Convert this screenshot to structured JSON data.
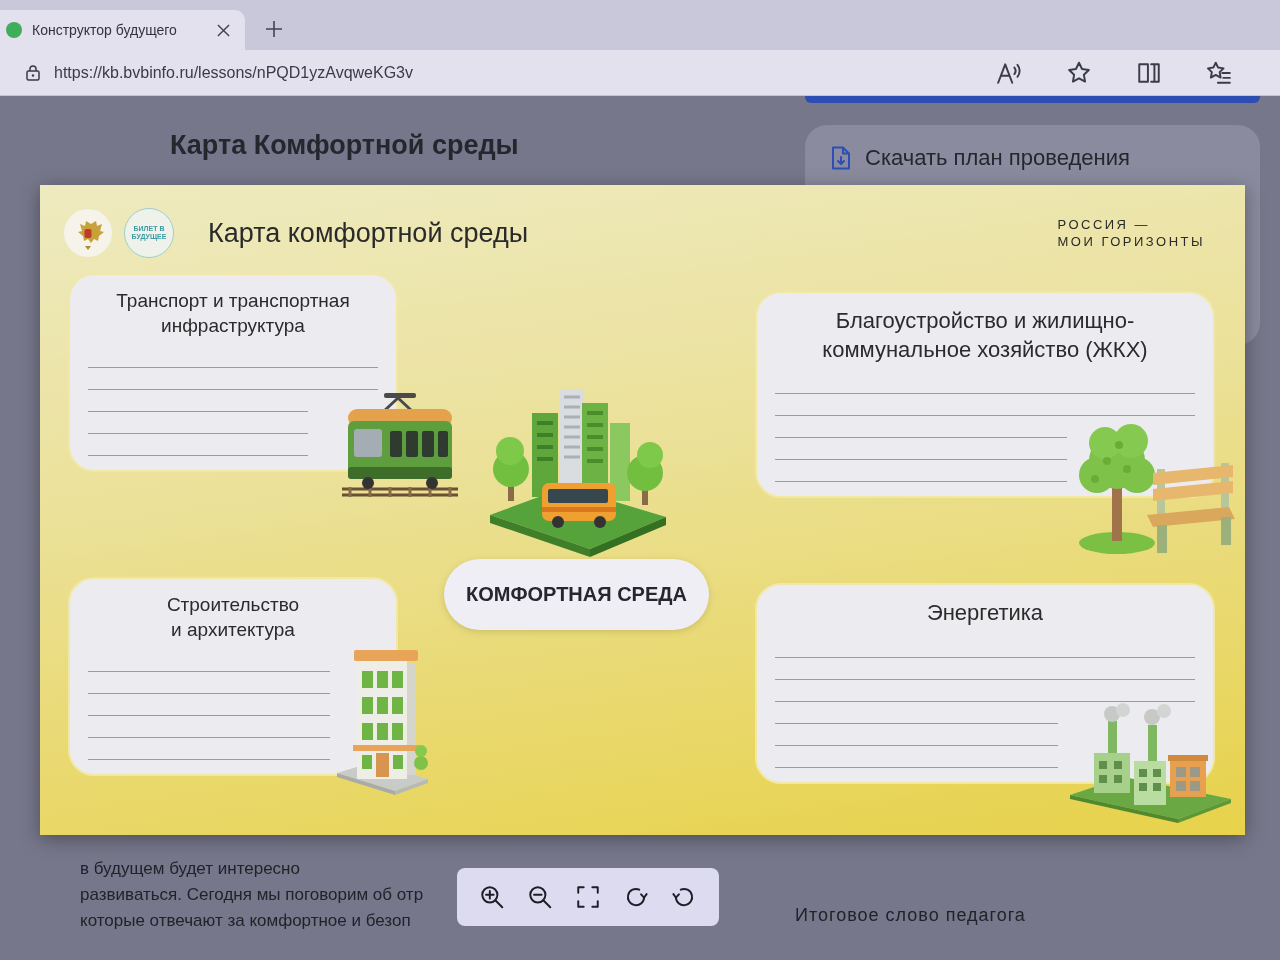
{
  "browser": {
    "tab": {
      "title": "Конструктор будущего"
    },
    "address": {
      "url": "https://kb.bvbinfo.ru/lessons/nPQD1yzAvqweKG3v"
    },
    "toolbar_buttons": [
      {
        "kind": "read_aloud"
      },
      {
        "kind": "favorite"
      },
      {
        "kind": "split_screen"
      },
      {
        "kind": "favorites"
      }
    ]
  },
  "page": {
    "heading": "Карта Комфортной среды",
    "side_panel": {
      "download_label": "Скачать план проведения"
    },
    "paragraph_lines": [
      "в будущем будет интересно",
      "развиваться. Сегодня мы поговорим об отр",
      "которые отвечают за комфортное и безоп"
    ],
    "final_item": "Итоговое слово педагога"
  },
  "slide": {
    "logo_text": "БИЛЕТ В БУДУЩЕЕ",
    "title": "Карта комфортной среды",
    "brand_lines": [
      "РОССИЯ —",
      "МОИ ГОРИЗОНТЫ"
    ],
    "cards": [
      {
        "title": "Транспорт и транспортная\nинфраструктура",
        "kind": "tram"
      },
      {
        "title": "Благоустройство и жилищно-\nкоммунальное хозяйство (ЖКХ)",
        "kind": "tree_bench"
      },
      {
        "title": "Строительство\nи архитектура",
        "kind": "building"
      },
      {
        "title": "Энергетика",
        "kind": "factory"
      }
    ],
    "center_label": "КОМФОРТНАЯ СРЕДА"
  },
  "viewer_toolbar": {
    "buttons": [
      {
        "kind": "zoom_in"
      },
      {
        "kind": "zoom_out"
      },
      {
        "kind": "fullscreen"
      },
      {
        "kind": "rotate_right"
      },
      {
        "kind": "rotate_left"
      }
    ]
  }
}
